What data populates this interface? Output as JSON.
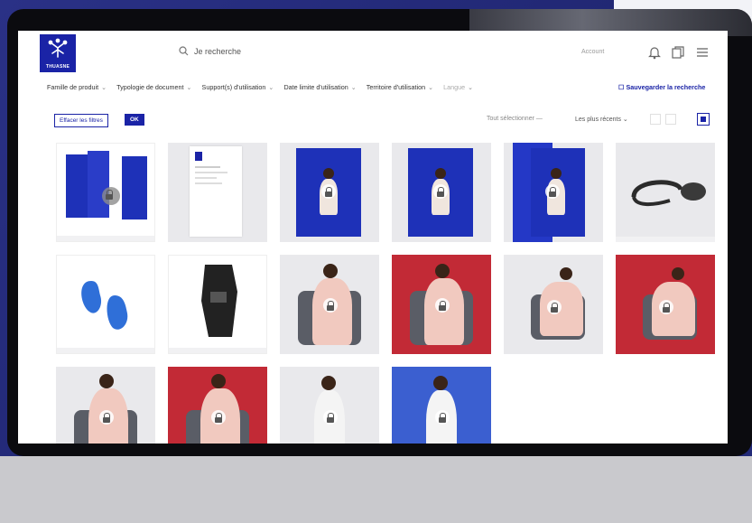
{
  "brand": {
    "logo_text": "THUASNE"
  },
  "search": {
    "placeholder": "Je recherche"
  },
  "account": {
    "label": "Account"
  },
  "filters": [
    {
      "label": "Famille de produit",
      "muted": false
    },
    {
      "label": "Typologie de document",
      "muted": false
    },
    {
      "label": "Support(s) d'utilisation",
      "muted": false
    },
    {
      "label": "Date limite d'utilisation",
      "muted": false
    },
    {
      "label": "Territoire d'utilisation",
      "muted": false
    },
    {
      "label": "Langue",
      "muted": true
    }
  ],
  "actions": {
    "save_search": "Sauvegarder la recherche",
    "clear_filters": "Effacer les filtres",
    "ok": "OK",
    "select_all": "Tout sélectionner",
    "sort": "Les plus récents"
  },
  "colors": {
    "brand": "#1a23a6",
    "accent_red": "#c22a36"
  },
  "assets": [
    {
      "kind": "brochure-set",
      "locked": true
    },
    {
      "kind": "document",
      "locked": false
    },
    {
      "kind": "brochure",
      "locked": true
    },
    {
      "kind": "brochure",
      "locked": true
    },
    {
      "kind": "brochure",
      "locked": true
    },
    {
      "kind": "product-pump",
      "locked": false
    },
    {
      "kind": "product-insoles",
      "locked": false
    },
    {
      "kind": "product-brace",
      "locked": false
    },
    {
      "kind": "photo-grey",
      "locked": true
    },
    {
      "kind": "photo-red",
      "locked": true
    },
    {
      "kind": "photo-grey",
      "locked": true
    },
    {
      "kind": "photo-red",
      "locked": true
    },
    {
      "kind": "photo-grey",
      "locked": true
    },
    {
      "kind": "photo-red",
      "locked": true
    },
    {
      "kind": "photo-grey",
      "locked": true
    },
    {
      "kind": "photo-blue",
      "locked": true
    }
  ]
}
